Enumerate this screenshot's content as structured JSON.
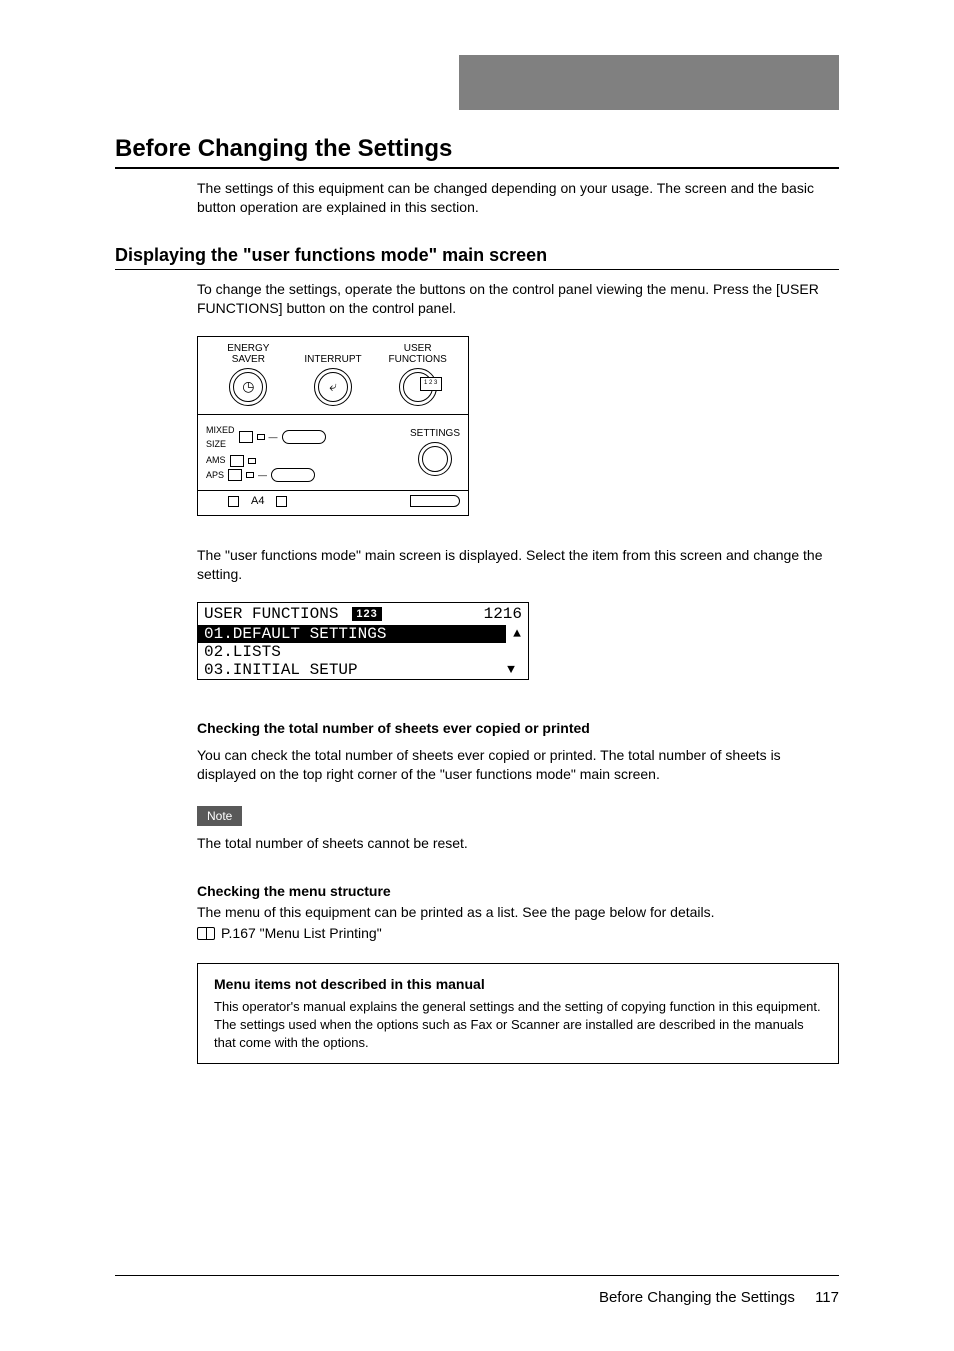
{
  "header": {
    "title": "Before Changing the Settings"
  },
  "intro_para": "The settings of this equipment can be changed depending on your usage. The screen and the basic button operation are explained in this section.",
  "section1": {
    "title": "Displaying the \"user functions mode\" main screen",
    "para": "To change the settings, operate the buttons on the control panel viewing the menu. Press the [USER FUNCTIONS] button on the control panel.",
    "after_para": "The \"user functions mode\" main screen is displayed. Select the item from this screen and change the setting."
  },
  "panel": {
    "btn1_l1": "ENERGY",
    "btn1_l2": "SAVER",
    "btn2": "INTERRUPT",
    "btn3_l1": "USER",
    "btn3_l2": "FUNCTIONS",
    "usrfn_badge": "1 2 3",
    "mixed_l1": "MIXED",
    "mixed_l2": "SIZE",
    "ams": "AMS",
    "aps": "APS",
    "settings": "SETTINGS",
    "a4": "A4"
  },
  "lcd": {
    "title": "USER FUNCTIONS",
    "badge": "123",
    "count": "1216",
    "row1": "01.DEFAULT SETTINGS",
    "row2": "02.LISTS",
    "row3": "03.INITIAL SETUP",
    "up": "▲",
    "down": "▼"
  },
  "section2": {
    "h4a": "Checking the total number of sheets ever copied or printed",
    "p_a": "You can check the total number of sheets ever copied or printed. The total number of sheets is displayed on the top right corner of the \"user functions mode\" main screen.",
    "note_label": "Note",
    "note_body": "The total number of sheets cannot be reset.",
    "h4b": "Checking the menu structure",
    "p_b": "The menu of this equipment can be printed as a list. See the page below for details.",
    "ref": "P.167 \"Menu List Printing\""
  },
  "infobox": {
    "title": "Menu items not described in this manual",
    "body": "This operator's manual explains the general settings and the setting of copying function in this equipment. The settings used when the options such as Fax or Scanner are installed are described in the manuals that come with the options."
  },
  "footer": {
    "text": "Before Changing the Settings",
    "page": "117"
  }
}
